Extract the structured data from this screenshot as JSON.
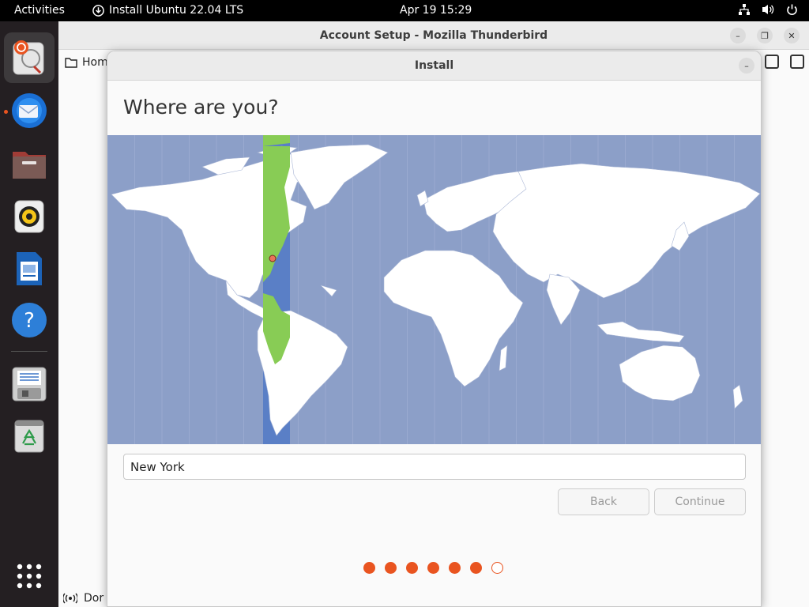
{
  "topbar": {
    "activities": "Activities",
    "app_menu": "Install Ubuntu 22.04 LTS",
    "clock": "Apr 19  15:29",
    "tray_icons": [
      "network-icon",
      "volume-icon",
      "power-icon"
    ]
  },
  "dock": {
    "items": [
      {
        "name": "Install Ubuntu",
        "icon": "ubuntu-installer-icon",
        "running": true,
        "active": true
      },
      {
        "name": "Thunderbird Mail",
        "icon": "thunderbird-icon",
        "running": true
      },
      {
        "name": "Files",
        "icon": "files-icon"
      },
      {
        "name": "Rhythmbox",
        "icon": "rhythmbox-icon"
      },
      {
        "name": "LibreOffice Writer",
        "icon": "writer-icon"
      },
      {
        "name": "Help",
        "icon": "help-icon"
      },
      {
        "name": "Save drive",
        "icon": "drive-icon"
      },
      {
        "name": "Trash",
        "icon": "trash-icon"
      },
      {
        "name": "Show Applications",
        "icon": "app-grid-icon"
      }
    ]
  },
  "thunderbird": {
    "title": "Account Setup - Mozilla Thunderbird",
    "home_tab": "Hom",
    "status_text": "Dor"
  },
  "installer": {
    "window_title": "Install",
    "heading": "Where are you?",
    "timezone_value": "New York",
    "back_label": "Back",
    "continue_label": "Continue",
    "progress_total": 7,
    "progress_completed": 6,
    "colors": {
      "ocean": "#8c9fc8",
      "land": "#ffffff",
      "selected_zone": "#5a7fc6",
      "selected_land": "#88cc55",
      "accent": "#e95420"
    }
  }
}
